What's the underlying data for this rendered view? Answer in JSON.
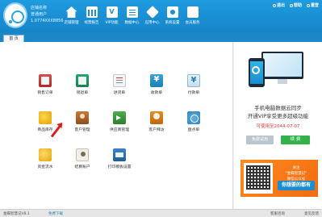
{
  "header": {
    "user_line1": "店铺名称",
    "user_line2": "普通用户",
    "user_line3": "1.0774XXX8856"
  },
  "nav": [
    {
      "label": "店铺管理",
      "icon": "home-icon"
    },
    {
      "label": "经营报告",
      "icon": "bar-chart-icon"
    },
    {
      "label": "VIP功能",
      "icon": "vip-icon"
    },
    {
      "label": "数据中心",
      "icon": "document-icon"
    },
    {
      "label": "应用中心",
      "icon": "cube-icon"
    },
    {
      "label": "系统设置",
      "icon": "gear-icon"
    },
    {
      "label": "会员服务",
      "icon": "heart-icon"
    }
  ],
  "window_buttons": {
    "exit": "退出",
    "about": "帮助",
    "relogin": "重登"
  },
  "tabs": {
    "home": "首 页"
  },
  "grid": [
    {
      "label": "销售订单",
      "icon": "sales-order-icon"
    },
    {
      "label": "销退单",
      "icon": "sales-return-icon"
    },
    {
      "label": "进货单",
      "icon": "purchase-order-icon"
    },
    {
      "label": "收款单",
      "icon": "receipt-icon"
    },
    {
      "label": "付款单",
      "icon": "payment-icon"
    },
    {
      "label": "商品库存",
      "icon": "inventory-icon"
    },
    {
      "label": "客户管理",
      "icon": "customer-icon"
    },
    {
      "label": "供应商管理",
      "icon": "supplier-icon"
    },
    {
      "label": "客户拜访",
      "icon": "visit-icon"
    },
    {
      "label": "盘点单",
      "icon": "stocktake-icon"
    },
    {
      "label": "资金流水",
      "icon": "cash-flow-icon"
    },
    {
      "label": "结算账户",
      "icon": "settlement-icon"
    },
    {
      "label": "打印模板设置",
      "icon": "printer-icon"
    }
  ],
  "side": {
    "promo_line1": "手机电脑数据云同步",
    "promo_line2": "开通VIP享受更多超级功能",
    "expiry": "可使用至2044-07-07",
    "trial_button": "免费试用",
    "renew_button": "续 费",
    "qr_caption": "关注\n\"金蝶智慧记\"\n微信公众号",
    "qr_slogan": "你想要的都有"
  },
  "status": {
    "version": "金蝶智慧记V8.1",
    "link": "免费下载",
    "left2": "",
    "right1": "客服咨询",
    "right2": "意见反馈"
  }
}
